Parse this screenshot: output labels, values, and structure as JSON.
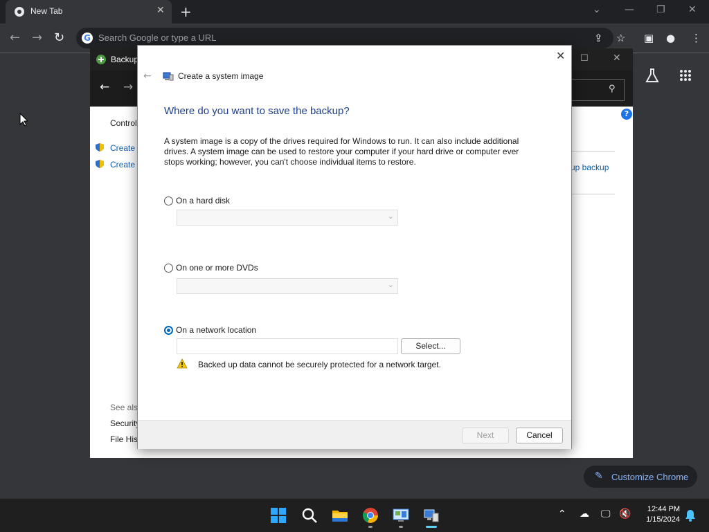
{
  "browser": {
    "tab_title": "New Tab",
    "omnibox_placeholder": "Search Google or type a URL",
    "customize_label": "Customize Chrome"
  },
  "control_panel": {
    "title": "Backup",
    "sidebar_home": "Control",
    "sidebar_items": [
      "Create a",
      "Create a"
    ],
    "see_also": "See also",
    "see_also_items": [
      "Security",
      "File Hist"
    ],
    "right_link": "up backup"
  },
  "dialog": {
    "title": "Create a system image",
    "heading": "Where do you want to save the backup?",
    "description": "A system image is a copy of the drives required for Windows to run. It can also include additional drives. A system image can be used to restore your computer if your hard drive or computer ever stops working; however, you can't choose individual items to restore.",
    "options": [
      {
        "label": "On a hard disk",
        "selected": false
      },
      {
        "label": "On one or more DVDs",
        "selected": false
      },
      {
        "label": "On a network location",
        "selected": true
      }
    ],
    "network_path": "",
    "select_button": "Select...",
    "warning": "Backed up data cannot be securely protected for a network target.",
    "next_button": "Next",
    "cancel_button": "Cancel"
  },
  "taskbar": {
    "time": "12:44 PM",
    "date": "1/15/2024"
  },
  "colors": {
    "accent": "#0067c0",
    "heading": "#1e3e8a",
    "link": "#0b5cad"
  }
}
